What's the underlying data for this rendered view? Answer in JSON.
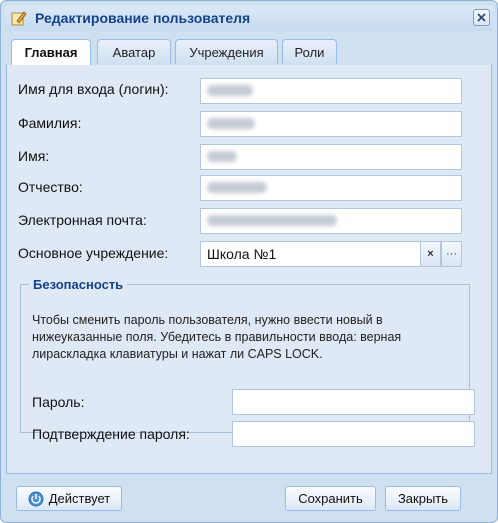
{
  "window": {
    "title": "Редактирование пользователя"
  },
  "tabs": [
    {
      "label": "Главная",
      "active": true
    },
    {
      "label": "Аватар",
      "active": false
    },
    {
      "label": "Учреждения",
      "active": false
    },
    {
      "label": "Роли",
      "active": false
    }
  ],
  "form": {
    "login_label": "Имя для входа (логин):",
    "lastname_label": "Фамилия:",
    "firstname_label": "Имя:",
    "patronymic_label": "Отчество:",
    "email_label": "Электронная почта:",
    "institution_label": "Основное учреждение:",
    "institution_value": "Школа №1",
    "clear_symbol": "×",
    "browse_symbol": "···"
  },
  "security": {
    "legend": "Безопасность",
    "hint": "Чтобы сменить пароль пользователя, нужно ввести новый в нижеуказанные поля. Убедитесь в правильности ввода: верная лираскладка клавиатуры и нажат ли CAPS LOCK.",
    "password_label": "Пароль:",
    "confirm_label": "Подтверждение пароля:"
  },
  "buttons": {
    "status": "Действует",
    "save": "Сохранить",
    "close": "Закрыть"
  },
  "colors": {
    "title": "#15428b",
    "window_bg": "#cfe0f1",
    "panel_bg": "#dfe8f5",
    "border": "#99bbe8"
  }
}
